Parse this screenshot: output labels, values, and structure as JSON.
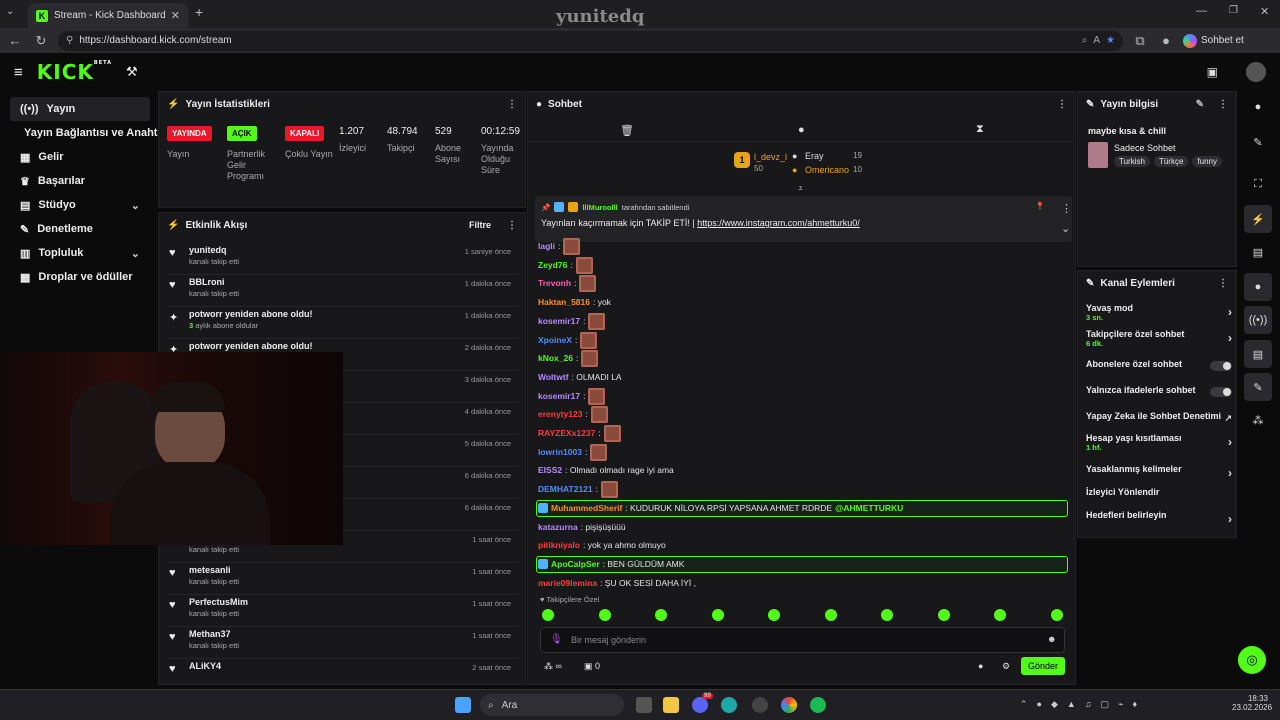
{
  "browser": {
    "tab_title": "Stream - Kick Dashboard",
    "url": "https://dashboard.kick.com/stream",
    "chat_button": "Sohbet et",
    "watermark": "yunitedq"
  },
  "app": {
    "logo": "KICK",
    "beta": "BETA"
  },
  "sidebar": {
    "items": [
      {
        "label": "Yayın",
        "icon": "broadcast-icon"
      },
      {
        "label": "Yayın Bağlantısı ve Anahtarı",
        "icon": ""
      },
      {
        "label": "Gelir",
        "icon": "revenue-icon"
      },
      {
        "label": "Başarılar",
        "icon": "trophy-icon"
      },
      {
        "label": "Stüdyo",
        "icon": "studio-icon"
      },
      {
        "label": "Denetleme",
        "icon": "wrench-icon"
      },
      {
        "label": "Topluluk",
        "icon": "community-icon"
      },
      {
        "label": "Droplar ve ödüller",
        "icon": "gift-icon"
      }
    ]
  },
  "stats": {
    "title": "Yayın İstatistikleri",
    "live_badge": "YAYINDA",
    "live_label": "Yayın",
    "partner_badge": "AÇIK",
    "partner_label": "Partnerlik Gelir Programı",
    "multi_badge": "KAPALI",
    "multi_label": "Çoklu Yayın",
    "viewers": "1.207",
    "viewers_label": "İzleyici",
    "followers": "48.794",
    "followers_label": "Takipçi",
    "subs": "529",
    "subs_label": "Abone Sayısı",
    "uptime": "00:12:59",
    "uptime_label": "Yayında Olduğu Süre"
  },
  "feed": {
    "title": "Etkinlik Akışı",
    "filter": "Filtre",
    "items": [
      {
        "name": "yunitedq",
        "sub": "kanalı takip etti",
        "time": "1 saniye önce",
        "icon": "heart-icon"
      },
      {
        "name": "BBLroni",
        "sub": "kanalı takip etti",
        "time": "1 dakika önce",
        "icon": "heart-icon"
      },
      {
        "name": "potworr yeniden abone oldu!",
        "sub_num": "3",
        "sub": "aylık abone oldular",
        "time": "1 dakika önce",
        "icon": "star-icon"
      },
      {
        "name": "potworr yeniden abone oldu!",
        "sub": "",
        "time": "2 dakika önce",
        "icon": "star-icon"
      },
      {
        "name": "",
        "sub": "",
        "time": "3 dakika önce"
      },
      {
        "name": "",
        "sub": "",
        "time": "4 dakika önce"
      },
      {
        "name": "",
        "sub": "",
        "time": "5 dakika önce"
      },
      {
        "name": "",
        "sub": "",
        "time": "6 dakika önce"
      },
      {
        "name": "",
        "sub": "",
        "time": "6 dakika önce"
      },
      {
        "name": "",
        "sub": "kanalı takip etti",
        "time": "1 saat önce",
        "icon": "heart-icon"
      },
      {
        "name": "metesanli",
        "sub": "kanalı takip etti",
        "time": "1 saat önce",
        "icon": "heart-icon"
      },
      {
        "name": "PerfectusMim",
        "sub": "kanalı takip etti",
        "time": "1 saat önce",
        "icon": "heart-icon"
      },
      {
        "name": "Methan37",
        "sub": "kanalı takip etti",
        "time": "1 saat önce",
        "icon": "heart-icon"
      },
      {
        "name": "ALiKY4",
        "sub": "",
        "time": "2 saat önce",
        "icon": "heart-icon"
      }
    ]
  },
  "chat": {
    "title": "Sohbet",
    "leaders": [
      {
        "rank": "1",
        "name": "l_devz_l",
        "score": "50"
      },
      {
        "name": "Eray",
        "score": "19"
      },
      {
        "name": "Omericano",
        "score": "10"
      }
    ],
    "pinned_by": "lllMuroolll",
    "pinned_suffix": "tarafından sabitlendi",
    "pinned_text": "Yayınları kaçırmamak için TAKİP ETİ! |",
    "pinned_link": "https://www.instagram.com/ahmetturku0/",
    "messages": [
      {
        "user": "lagli",
        "color": "#b58bff",
        "text": ":",
        "emote": true
      },
      {
        "user": "Zeyd76",
        "color": "#53fc18",
        "text": ":",
        "emote": true
      },
      {
        "user": "Trevonh",
        "color": "#ff5ab4",
        "text": ":",
        "emote": true
      },
      {
        "user": "Haktan_5816",
        "color": "#ff8c2a",
        "text": ": yok",
        "emote": false
      },
      {
        "user": "kosemir17",
        "color": "#b58bff",
        "text": ":",
        "emote": true
      },
      {
        "user": "XpoineX",
        "color": "#4f8cff",
        "text": ":",
        "emote": true
      },
      {
        "user": "kNox_26",
        "color": "#53fc18",
        "text": ":",
        "emote": true
      },
      {
        "user": "Woltwtf",
        "color": "#b58bff",
        "text": ": OLMADI LA",
        "emote": false
      },
      {
        "user": "kosemir17",
        "color": "#b58bff",
        "text": ":",
        "emote": true
      },
      {
        "user": "erenyty123",
        "color": "#ff3b3b",
        "text": ":",
        "emote": true
      },
      {
        "user": "RAYZEXx1237",
        "color": "#ff3b3b",
        "text": ":",
        "emote": true
      },
      {
        "user": "lowrin1003",
        "color": "#4f8cff",
        "text": ":",
        "emote": true
      },
      {
        "user": "EISS2",
        "color": "#b58bff",
        "text": ": Olmadı olmadı rage iyi ama",
        "emote": false
      },
      {
        "user": "DEMHAT2121",
        "color": "#4f8cff",
        "text": ":",
        "emote": true
      },
      {
        "user": "MuhammedSherif",
        "color": "#ff8c2a",
        "text": ": KUDURUK NİLOYA RPSİ YAPSANA AHMET RDRDE",
        "mention": "@AHMETTURKU",
        "emote": false,
        "highlight": true
      },
      {
        "user": "katazurna",
        "color": "#b58bff",
        "text": ": pişişüşüüü",
        "emote": false
      },
      {
        "user": "pitikniyalo",
        "color": "#ff3b3b",
        "text": ": yok ya ahmo olmuyo",
        "emote": false
      },
      {
        "user": "ApoCalpSer",
        "color": "#53fc18",
        "text": ": BEN GÜLDÜM AMK",
        "emote": false,
        "highlight": true
      },
      {
        "user": "marie09lemina",
        "color": "#ff3b3b",
        "text": ": ŞU OK SESİ DAHA İYİ ,",
        "emote": false
      }
    ],
    "followers_only": "Takipçilere Özel",
    "input_placeholder": "Bir mesaj gönderin",
    "points": "0",
    "send": "Gönder"
  },
  "info": {
    "title": "Yayın bilgisi",
    "stream_title": "maybe kısa & chill",
    "category": "Sadece Sohbet",
    "tags": [
      "Turkish",
      "Türkçe",
      "funny"
    ]
  },
  "actions": {
    "title": "Kanal Eylemleri",
    "items": [
      {
        "label": "Yavaş mod",
        "sub": "3 sn.",
        "control": "arrow"
      },
      {
        "label": "Takipçilere özel sohbet",
        "sub": "6 dk.",
        "control": "arrow"
      },
      {
        "label": "Abonelere özel sohbet",
        "sub": "",
        "control": "toggle"
      },
      {
        "label": "Yalnızca ifadelerle sohbet",
        "sub": "",
        "control": "toggle"
      },
      {
        "label": "Yapay Zeka ile Sohbet Denetimi",
        "sub": "",
        "control": "external"
      },
      {
        "label": "Hesap yaşı kısıtlaması",
        "sub": "1 hf.",
        "control": "arrow"
      },
      {
        "label": "Yasaklanmış kelimeler",
        "sub": "",
        "control": "arrow"
      },
      {
        "label": "İzleyici Yönlendir",
        "sub": "",
        "control": "none"
      },
      {
        "label": "Hedefleri belirleyin",
        "sub": "",
        "control": "arrow"
      }
    ]
  },
  "taskbar": {
    "search": "Ara",
    "time": "18:33",
    "date": "23.02.2026",
    "discord_badge": "99"
  },
  "colors": {
    "accent": "#53fc18",
    "live": "#e8172c",
    "panel": "#18181b",
    "bg": "#0b0b0c"
  }
}
